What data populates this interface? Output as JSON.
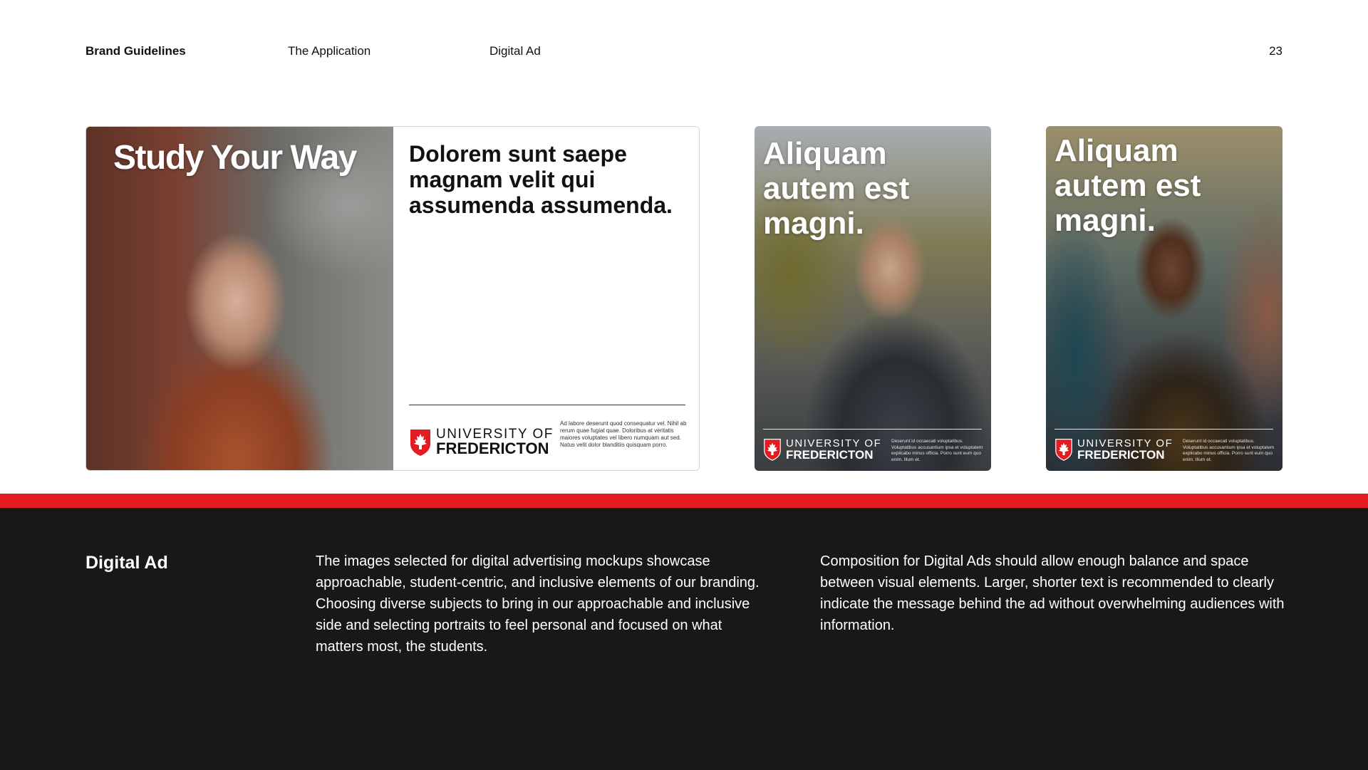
{
  "header": {
    "brand": "Brand Guidelines",
    "section": "The Application",
    "topic": "Digital Ad",
    "page_number": "23"
  },
  "logo": {
    "line1": "UNIVERSITY OF",
    "line2": "FREDERICTON",
    "shield_color": "#e31b23"
  },
  "ads": {
    "landscape": {
      "headline": "Study Your Way",
      "title": "Dolorem sunt saepe magnam velit qui assumenda assumenda.",
      "body": "Ad labore deserunt quod consequatur vel. Nihil ab rerum quae fugiat quae. Doloribus at veritatis maiores voluptates vel libero numquam aut sed. Natus velit dolor blanditiis quisquam porro."
    },
    "portrait_1": {
      "headline": "Aliquam autem est magni.",
      "body": "Deserunt id occaecati voluptatibus. Voluptatibus accusantium ipsa et voluptatem explicabo minus officia. Porro sunt eum quo enim. Illum et."
    },
    "portrait_2": {
      "headline": "Aliquam autem est magni.",
      "body": "Deserunt id occaecati voluptatibus. Voluptatibus accusantium ipsa et voluptatem explicabo minus officia. Porro sunt eum quo enim. Illum et."
    }
  },
  "footer": {
    "title": "Digital Ad",
    "paragraph_1": "The images selected for digital advertising mockups showcase approachable, student-centric, and inclusive elements of our branding. Choosing diverse subjects to bring in our approachable and inclusive side and selecting portraits to feel personal and focused on what matters most, the students.",
    "paragraph_2": "Composition for Digital Ads should allow enough balance and space between visual elements. Larger, shorter text is recommended to clearly indicate the message behind the ad without overwhelming audiences with information."
  },
  "colors": {
    "accent_red": "#e31b23",
    "dark_panel": "#181818"
  }
}
